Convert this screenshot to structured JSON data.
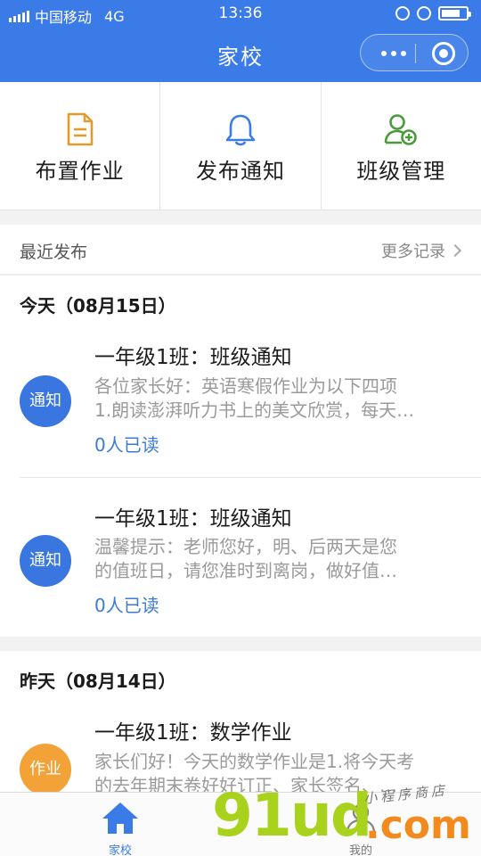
{
  "status_bar": {
    "carrier": "中国移动",
    "network": "4G",
    "time": "13:36",
    "battery_level": 0.75
  },
  "nav": {
    "title": "家校"
  },
  "quick_actions": [
    {
      "label": "布置作业",
      "icon": "document-icon",
      "color": "#e49b2c"
    },
    {
      "label": "发布通知",
      "icon": "bell-icon",
      "color": "#3b7be8"
    },
    {
      "label": "班级管理",
      "icon": "user-add-icon",
      "color": "#4a9a3c"
    }
  ],
  "recent": {
    "title": "最近发布",
    "more": "更多记录"
  },
  "groups": [
    {
      "date": "今天（08月15日）",
      "items": [
        {
          "badge": "通知",
          "badge_color": "#3a76e0",
          "title": "一年级1班：班级通知",
          "line1": "各位家长好：英语寒假作业为以下四项",
          "line2": "1.朗读澎湃听力书上的美文欣赏，每天…",
          "read": "0人已读"
        },
        {
          "badge": "通知",
          "badge_color": "#3a76e0",
          "title": "一年级1班：班级通知",
          "line1": "温馨提示：老师您好，明、后两天是您",
          "line2": "的值班日，请您准时到离岗，做好值…",
          "read": "0人已读"
        }
      ]
    },
    {
      "date": "昨天（08月14日）",
      "items": [
        {
          "badge": "作业",
          "badge_color": "#f2a236",
          "title": "一年级1班：数学作业",
          "line1": "家长们好！今天的数学作业是1.将今天考",
          "line2": "的去年期末卷好好订正、家长签名、…"
        }
      ]
    }
  ],
  "tabbar": {
    "home": "家校",
    "mine": "我的"
  },
  "watermark": {
    "brand": "91ud",
    "domain": ".com",
    "slogan": "小程序商店"
  }
}
